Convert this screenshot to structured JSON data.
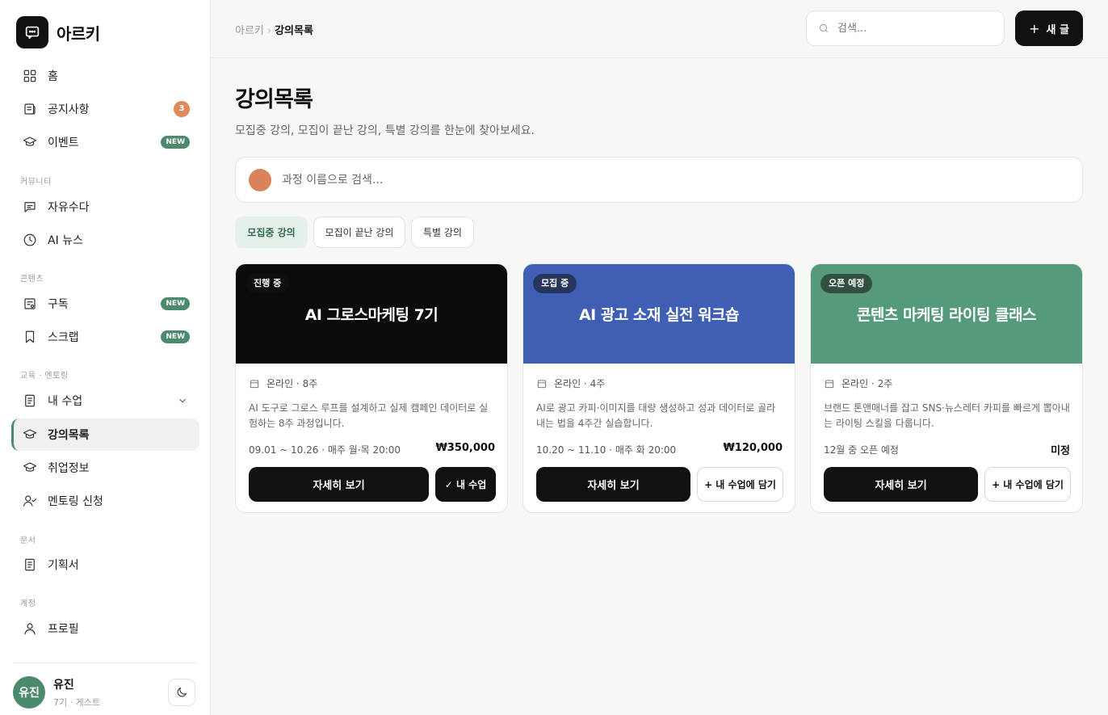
{
  "app": {
    "brand_name": "아르키"
  },
  "sidebar": {
    "items": [
      {
        "label": "홈",
        "icon": "grid-icon"
      },
      {
        "label": "공지사항",
        "icon": "notice-icon",
        "badge": "3"
      },
      {
        "label": "이벤트",
        "icon": "graduation-cap-icon",
        "badge": "NEW"
      },
      {
        "label": "자유수다",
        "icon": "chat-icon"
      },
      {
        "label": "AI 뉴스",
        "icon": "clock-icon"
      },
      {
        "label": "구독",
        "icon": "subscribe-icon",
        "badge": "NEW"
      },
      {
        "label": "스크랩",
        "icon": "bookmark-icon",
        "badge": "NEW"
      },
      {
        "label": "내 수업",
        "icon": "document-icon"
      },
      {
        "label": "강의목록",
        "icon": "graduation-cap-icon",
        "active": true
      },
      {
        "label": "취업정보",
        "icon": "graduation-cap-icon"
      },
      {
        "label": "멘토링 신청",
        "icon": "user-check-icon"
      },
      {
        "label": "기획서",
        "icon": "document-icon"
      },
      {
        "label": "프로필",
        "icon": "user-icon"
      }
    ],
    "sections": [
      "커뮤니티",
      "콘텐츠",
      "교육 · 멘토링",
      "문서",
      "계정"
    ],
    "user": {
      "avatar_text": "유진",
      "name": "유진",
      "subtitle": "7기 · 게스트"
    }
  },
  "topbar": {
    "breadcrumb": [
      "아르키",
      "강의목록"
    ],
    "search_placeholder": "검색...",
    "new_button": "새 글"
  },
  "main": {
    "title": "강의목록",
    "subtitle": "모집중 강의, 모집이 끝난 강의, 특별 강의를 한눈에 찾아보세요.",
    "search_placeholder": "과정 이름으로 검색...",
    "tabs": [
      {
        "label": "모집중 강의",
        "active": true
      },
      {
        "label": "모집이 끝난 강의"
      },
      {
        "label": "특별 강의"
      }
    ],
    "cards": [
      {
        "status": "진행 중",
        "title": "AI 그로스마케팅 7기",
        "color": "#0b0b0b",
        "meta": "온라인 · 8주",
        "desc": "AI 도구로 그로스 루프를 설계하고 실제 캠페인 데이터로 실험하는 8주 과정입니다.",
        "schedule": "09.01 ~ 10.26 · 매주 월·목 20:00",
        "price": "₩350,000",
        "detail_button": "자세히 보기",
        "secondary_button": "✓ 내 수업"
      },
      {
        "status": "모집 중",
        "title": "AI 광고 소재 실전 워크숍",
        "color": "#3f5fb5",
        "meta": "온라인 · 4주",
        "desc": "AI로 광고 카피·이미지를 대량 생성하고 성과 데이터로 골라내는 법을 4주간 실습합니다.",
        "schedule": "10.20 ~ 11.10 · 매주 화 20:00",
        "price": "₩120,000",
        "detail_button": "자세히 보기",
        "secondary_button": "+ 내 수업에 담기"
      },
      {
        "status": "오픈 예정",
        "title": "콘텐츠 마케팅 라이팅 클래스",
        "color": "#559a7a",
        "meta": "온라인 · 2주",
        "desc": "브랜드 톤앤매너를 잡고 SNS·뉴스레터 카피를 빠르게 뽑아내는 라이팅 스킬을 다룹니다.",
        "schedule": "12월 중 오픈 예정",
        "price": "미정",
        "detail_button": "자세히 보기",
        "secondary_button": "+ 내 수업에 담기"
      }
    ]
  }
}
